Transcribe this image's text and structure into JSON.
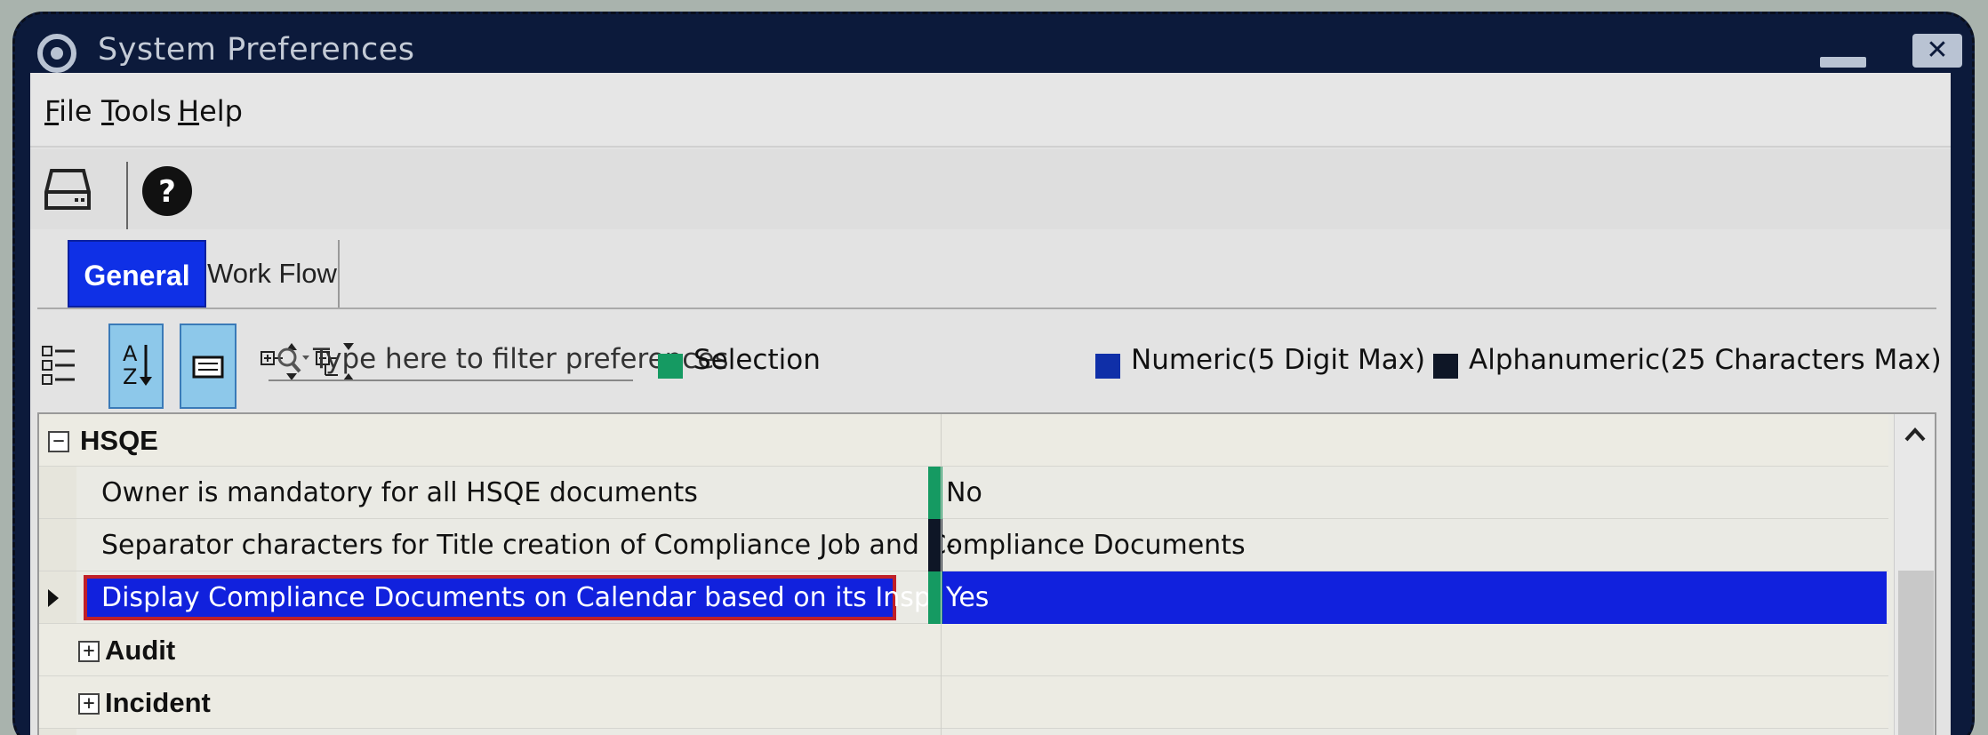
{
  "window": {
    "title": "System Preferences",
    "close_glyph": "✕"
  },
  "menubar": {
    "items": [
      {
        "mnemonic": "F",
        "rest": "ile"
      },
      {
        "mnemonic": "T",
        "rest": "ools"
      },
      {
        "mnemonic": "H",
        "rest": "elp"
      }
    ]
  },
  "toolbar": {
    "icons": [
      "save-drive-icon",
      "help-icon"
    ]
  },
  "tabs": {
    "items": [
      {
        "label": "General",
        "active": true
      },
      {
        "label": "Work Flow",
        "active": false
      }
    ]
  },
  "filter": {
    "placeholder": "Type here to filter preferences"
  },
  "legend": {
    "items": [
      {
        "label": "Selection",
        "color": "#159a62"
      },
      {
        "label": "Numeric(5 Digit Max)",
        "color": "#0f2fa8"
      },
      {
        "label": "Alphanumeric(25 Characters Max)",
        "color": "#0e1626"
      }
    ]
  },
  "grid": {
    "groups": [
      {
        "name": "HSQE",
        "expanded": true,
        "rows": [
          {
            "name": "Owner is mandatory for all HSQE documents",
            "value": "No",
            "type_color": "#159a62",
            "selected": false
          },
          {
            "name": "Separator characters for Title creation of Compliance Job and Compliance Documents",
            "value": "-",
            "type_color": "#0e1626",
            "selected": false
          },
          {
            "name": "Display Compliance Documents on Calendar based on its Inspection Status",
            "value": "Yes",
            "type_color": "#159a62",
            "selected": true
          }
        ]
      },
      {
        "name": "Audit",
        "expanded": false
      },
      {
        "name": "Incident",
        "expanded": false
      }
    ],
    "expanded_glyph": "−",
    "collapsed_glyph": "+"
  }
}
